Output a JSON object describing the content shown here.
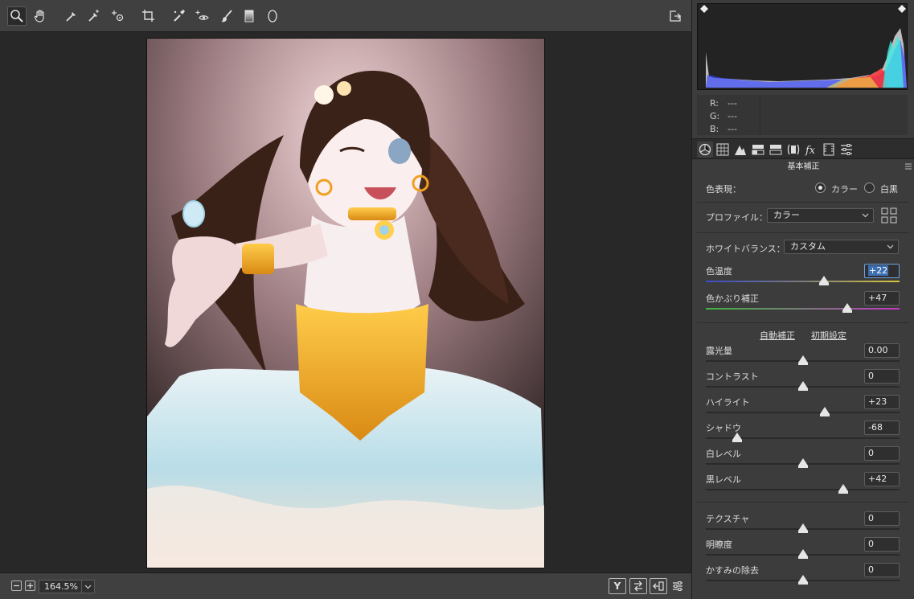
{
  "toolbar": {
    "tools": [
      "zoom-icon",
      "hand-icon",
      "white-balance-icon",
      "color-sampler-icon",
      "targeted-adjustment-icon",
      "crop-icon",
      "spot-removal-icon",
      "red-eye-icon",
      "adjustment-brush-icon",
      "graduated-filter-icon",
      "radial-filter-icon"
    ],
    "active_tool": "zoom-icon",
    "right_icon": "open-object-icon"
  },
  "status": {
    "zoom": "164.5%",
    "view_toggle_label": "Y",
    "icons": [
      "before-after-icon",
      "swap-settings-icon",
      "copy-settings-icon",
      "preferences-icon"
    ]
  },
  "readout": {
    "r_label": "R:",
    "r_value": "---",
    "g_label": "G:",
    "g_value": "---",
    "b_label": "B:",
    "b_value": "---"
  },
  "tabs": [
    "basic-panel-icon",
    "tone-curve-icon",
    "detail-icon",
    "hsl-icon",
    "split-toning-icon",
    "lens-corrections-icon",
    "effects-icon",
    "calibration-icon",
    "presets-icon"
  ],
  "panel": {
    "title": "基本補正",
    "treatment_label": "色表現：",
    "treatment_color": "カラー",
    "treatment_bw": "白黒",
    "treatment_selected": "color",
    "profile_label": "プロファイル：",
    "profile_value": "カラー",
    "wb_label": "ホワイトバランス：",
    "wb_value": "カスタム",
    "auto_label": "自動補正",
    "default_label": "初期設定"
  },
  "sliders": [
    {
      "key": "temp",
      "label": "色温度",
      "value": "+22",
      "pos": 0.61,
      "track": "temp",
      "selected": true
    },
    {
      "key": "tint",
      "label": "色かぶり補正",
      "value": "+47",
      "pos": 0.73,
      "track": "tint",
      "selected": false
    },
    {
      "key": "exposure",
      "label": "露光量",
      "value": "0.00",
      "pos": 0.5,
      "track": "plain",
      "selected": false
    },
    {
      "key": "contrast",
      "label": "コントラスト",
      "value": "0",
      "pos": 0.5,
      "track": "plain",
      "selected": false
    },
    {
      "key": "highlights",
      "label": "ハイライト",
      "value": "+23",
      "pos": 0.615,
      "track": "plain",
      "selected": false
    },
    {
      "key": "shadows",
      "label": "シャドウ",
      "value": "-68",
      "pos": 0.16,
      "track": "plain",
      "selected": false
    },
    {
      "key": "whites",
      "label": "白レベル",
      "value": "0",
      "pos": 0.5,
      "track": "plain",
      "selected": false
    },
    {
      "key": "blacks",
      "label": "黒レベル",
      "value": "+42",
      "pos": 0.71,
      "track": "plain",
      "selected": false
    },
    {
      "key": "texture",
      "label": "テクスチャ",
      "value": "0",
      "pos": 0.5,
      "track": "plain",
      "selected": false
    },
    {
      "key": "clarity",
      "label": "明瞭度",
      "value": "0",
      "pos": 0.5,
      "track": "plain",
      "selected": false
    },
    {
      "key": "dehaze",
      "label": "かすみの除去",
      "value": "0",
      "pos": 0.5,
      "track": "plain",
      "selected": false
    }
  ]
}
